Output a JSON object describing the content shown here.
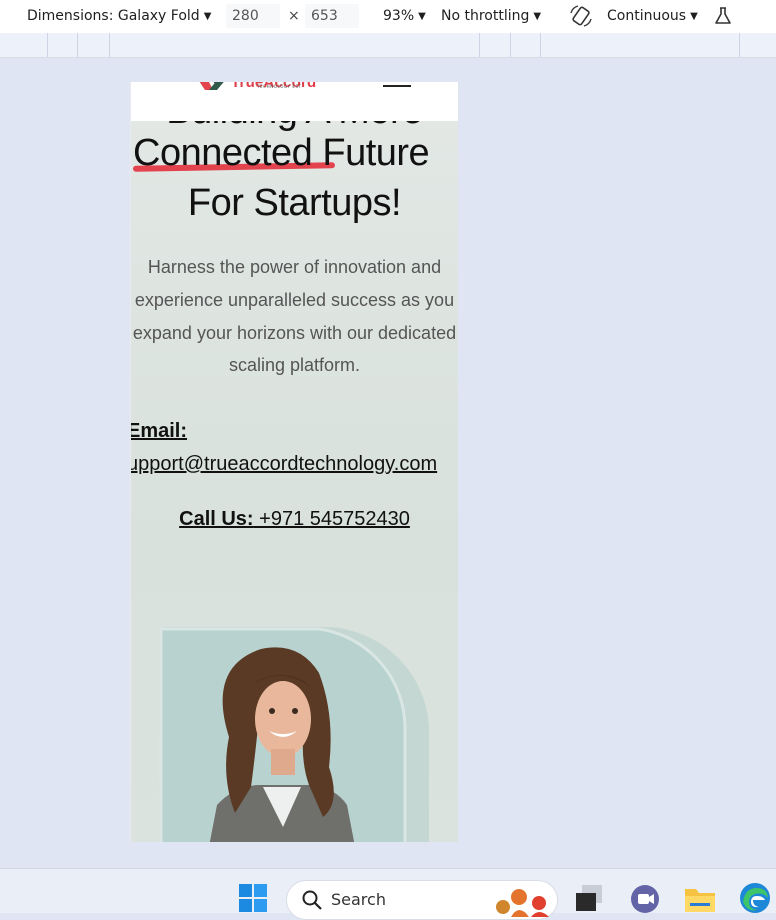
{
  "devtools": {
    "dimensions_label": "Dimensions: Galaxy Fold",
    "width_value": "280",
    "times_sign": "×",
    "height_value": "653",
    "zoom_label": "93%",
    "throttling_label": "No throttling",
    "mode_label": "Continuous"
  },
  "site": {
    "logo_text": "TrueAccord",
    "logo_subtext": "TECHNOLOGY EST",
    "hero_top_partial": "Building A More",
    "hero_line2_word": "Connected",
    "hero_line2_rest": " Future",
    "hero_line3": "For Startups!",
    "paragraph_lines": [
      "Harness the power of innovation and",
      "experience unparalleled success as you",
      "expand your horizons with our dedicated",
      "scaling platform."
    ],
    "email_label": "Email:",
    "email_value": "support@trueaccordtechnology.com",
    "call_label": "Call Us:",
    "call_value": " +971  545752430"
  },
  "taskbar": {
    "search_label": "Search"
  },
  "colors": {
    "accent_red": "#e2434d",
    "page_bg": "#dfe5f3"
  }
}
